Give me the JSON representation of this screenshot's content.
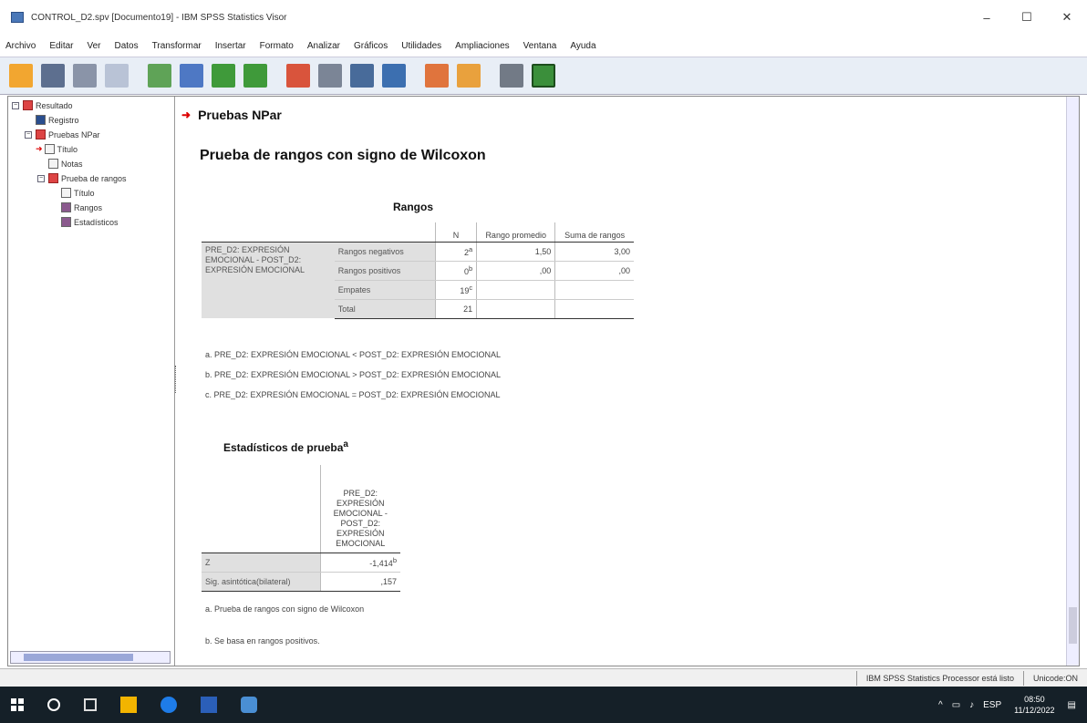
{
  "window": {
    "title": "CONTROL_D2.spv [Documento19] - IBM SPSS Statistics Visor",
    "minimize": "–",
    "maximize": "☐",
    "close": "✕"
  },
  "menu": [
    "Archivo",
    "Editar",
    "Ver",
    "Datos",
    "Transformar",
    "Insertar",
    "Formato",
    "Analizar",
    "Gráficos",
    "Utilidades",
    "Ampliaciones",
    "Ventana",
    "Ayuda"
  ],
  "toolbar": {
    "buttons": [
      "open-icon",
      "save-icon",
      "print-icon",
      "print-preview-icon",
      "export-icon",
      "recall-dialog-icon",
      "undo-icon",
      "redo-icon",
      "goto-data-icon",
      "goto-case-icon",
      "variables-icon",
      "insert-table-icon",
      "insert-output-icon",
      "insert-chart-icon",
      "designate-window-icon",
      "show-all-icon"
    ]
  },
  "outline": {
    "items": [
      "Resultado",
      "Registro",
      "Pruebas NPar",
      "Título",
      "Notas",
      "Prueba de rangos",
      "Título",
      "Rangos",
      "Estadísticos"
    ]
  },
  "viewer": {
    "heading": "Pruebas NPar",
    "subheading": "Prueba de rangos con signo de Wilcoxon",
    "rangos": {
      "title": "Rangos",
      "col_n": "N",
      "col_rango": "Rango promedio",
      "col_suma": "Suma de rangos",
      "row_group": "PRE_D2: EXPRESIÓN EMOCIONAL - POST_D2: EXPRESIÓN EMOCIONAL",
      "rows": [
        {
          "label": "Rangos negativos",
          "n": "2",
          "sup": "a",
          "rango": "1,50",
          "suma": "3,00"
        },
        {
          "label": "Rangos positivos",
          "n": "0",
          "sup": "b",
          "rango": ",00",
          "suma": ",00"
        },
        {
          "label": "Empates",
          "n": "19",
          "sup": "c",
          "rango": "",
          "suma": ""
        },
        {
          "label": "Total",
          "n": "21",
          "sup": "",
          "rango": "",
          "suma": ""
        }
      ],
      "footnotes": [
        "a. PRE_D2: EXPRESIÓN EMOCIONAL < POST_D2: EXPRESIÓN EMOCIONAL",
        "b. PRE_D2: EXPRESIÓN EMOCIONAL > POST_D2: EXPRESIÓN EMOCIONAL",
        "c. PRE_D2: EXPRESIÓN EMOCIONAL = POST_D2: EXPRESIÓN EMOCIONAL"
      ]
    },
    "estadisticos": {
      "title": "Estadísticos de prueba",
      "title_sup": "a",
      "col": "PRE_D2: EXPRESIÓN EMOCIONAL - POST_D2: EXPRESIÓN EMOCIONAL",
      "rows": [
        {
          "label": "Z",
          "value": "-1,414",
          "sup": "b"
        },
        {
          "label": "Sig. asintótica(bilateral)",
          "value": ",157",
          "sup": ""
        }
      ],
      "footnotes": [
        "a. Prueba de rangos con signo de Wilcoxon",
        "b. Se basa en rangos positivos."
      ]
    }
  },
  "statusbar": {
    "processor": "IBM SPSS Statistics Processor está listo",
    "unicode": "Unicode:ON"
  },
  "taskbar": {
    "time": "08:50",
    "date": "11/12/2022",
    "lang": "ESP"
  }
}
